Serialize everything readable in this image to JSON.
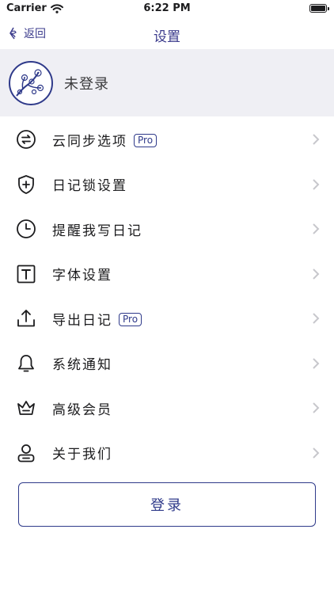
{
  "status_bar": {
    "carrier": "Carrier",
    "time": "6:22 PM"
  },
  "nav": {
    "back_label": "返回",
    "title": "设置"
  },
  "profile": {
    "login_status": "未登录"
  },
  "menu": {
    "items": [
      {
        "label": "云同步选项",
        "badge": "Pro",
        "icon": "sync-icon"
      },
      {
        "label": "日记锁设置",
        "badge": "",
        "icon": "shield-plus-icon"
      },
      {
        "label": "提醒我写日记",
        "badge": "",
        "icon": "clock-icon"
      },
      {
        "label": "字体设置",
        "badge": "",
        "icon": "text-icon"
      },
      {
        "label": "导出日记",
        "badge": "Pro",
        "icon": "upload-icon"
      },
      {
        "label": "系统通知",
        "badge": "",
        "icon": "bell-icon"
      },
      {
        "label": "高级会员",
        "badge": "",
        "icon": "crown-icon"
      },
      {
        "label": "关于我们",
        "badge": "",
        "icon": "user-icon"
      }
    ]
  },
  "login_button": {
    "label": "登录"
  },
  "colors": {
    "accent": "#2f3a8a",
    "profile_bg": "#efeff4",
    "chevron": "#c7c7cc"
  }
}
